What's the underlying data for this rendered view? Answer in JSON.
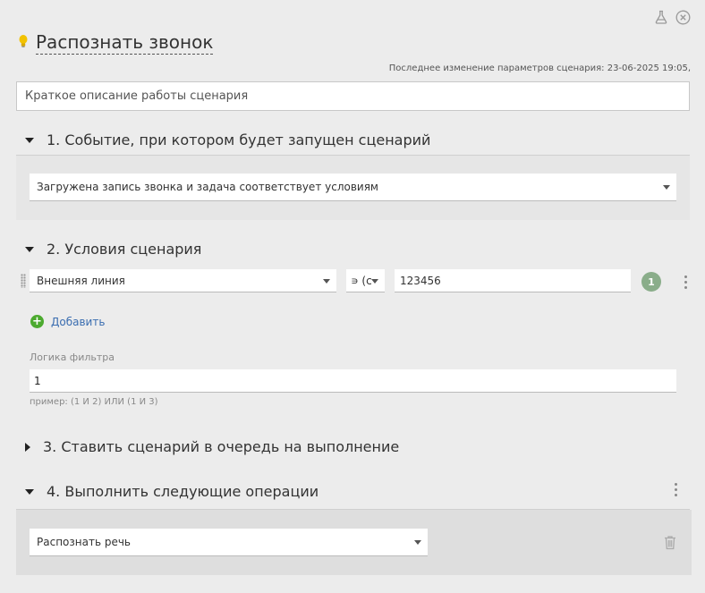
{
  "window": {
    "flask_icon": "flask-icon",
    "close_icon": "close-circle-icon"
  },
  "header": {
    "icon": "lightbulb-icon",
    "title": "Распознать звонок",
    "modified": "Последнее изменение параметров сценария: 23-06-2025 19:05,"
  },
  "description": {
    "placeholder": "Краткое описание работы сценария"
  },
  "section1": {
    "title": "1. Событие, при котором будет запущен сценарий",
    "event_value": "Загружена запись звонка и задача соответствует условиям"
  },
  "section2": {
    "title": "2. Условия сценария",
    "condition": {
      "field": "Внешняя линия",
      "operator": "∍ (с",
      "value": "123456",
      "badge": "1"
    },
    "add_label": "Добавить",
    "filter_label": "Логика фильтра",
    "filter_value": "1",
    "filter_hint": "пример: (1 И 2) ИЛИ (1 И 3)"
  },
  "section3": {
    "title": "3. Ставить сценарий в очередь на выполнение"
  },
  "section4": {
    "title": "4. Выполнить следующие операции",
    "operation": "Распознать речь"
  },
  "colors": {
    "accent_link": "#3a6db0",
    "add_green": "#4caa2f",
    "badge_green": "#8aad8a",
    "bulb_yellow": "#f2c200"
  }
}
